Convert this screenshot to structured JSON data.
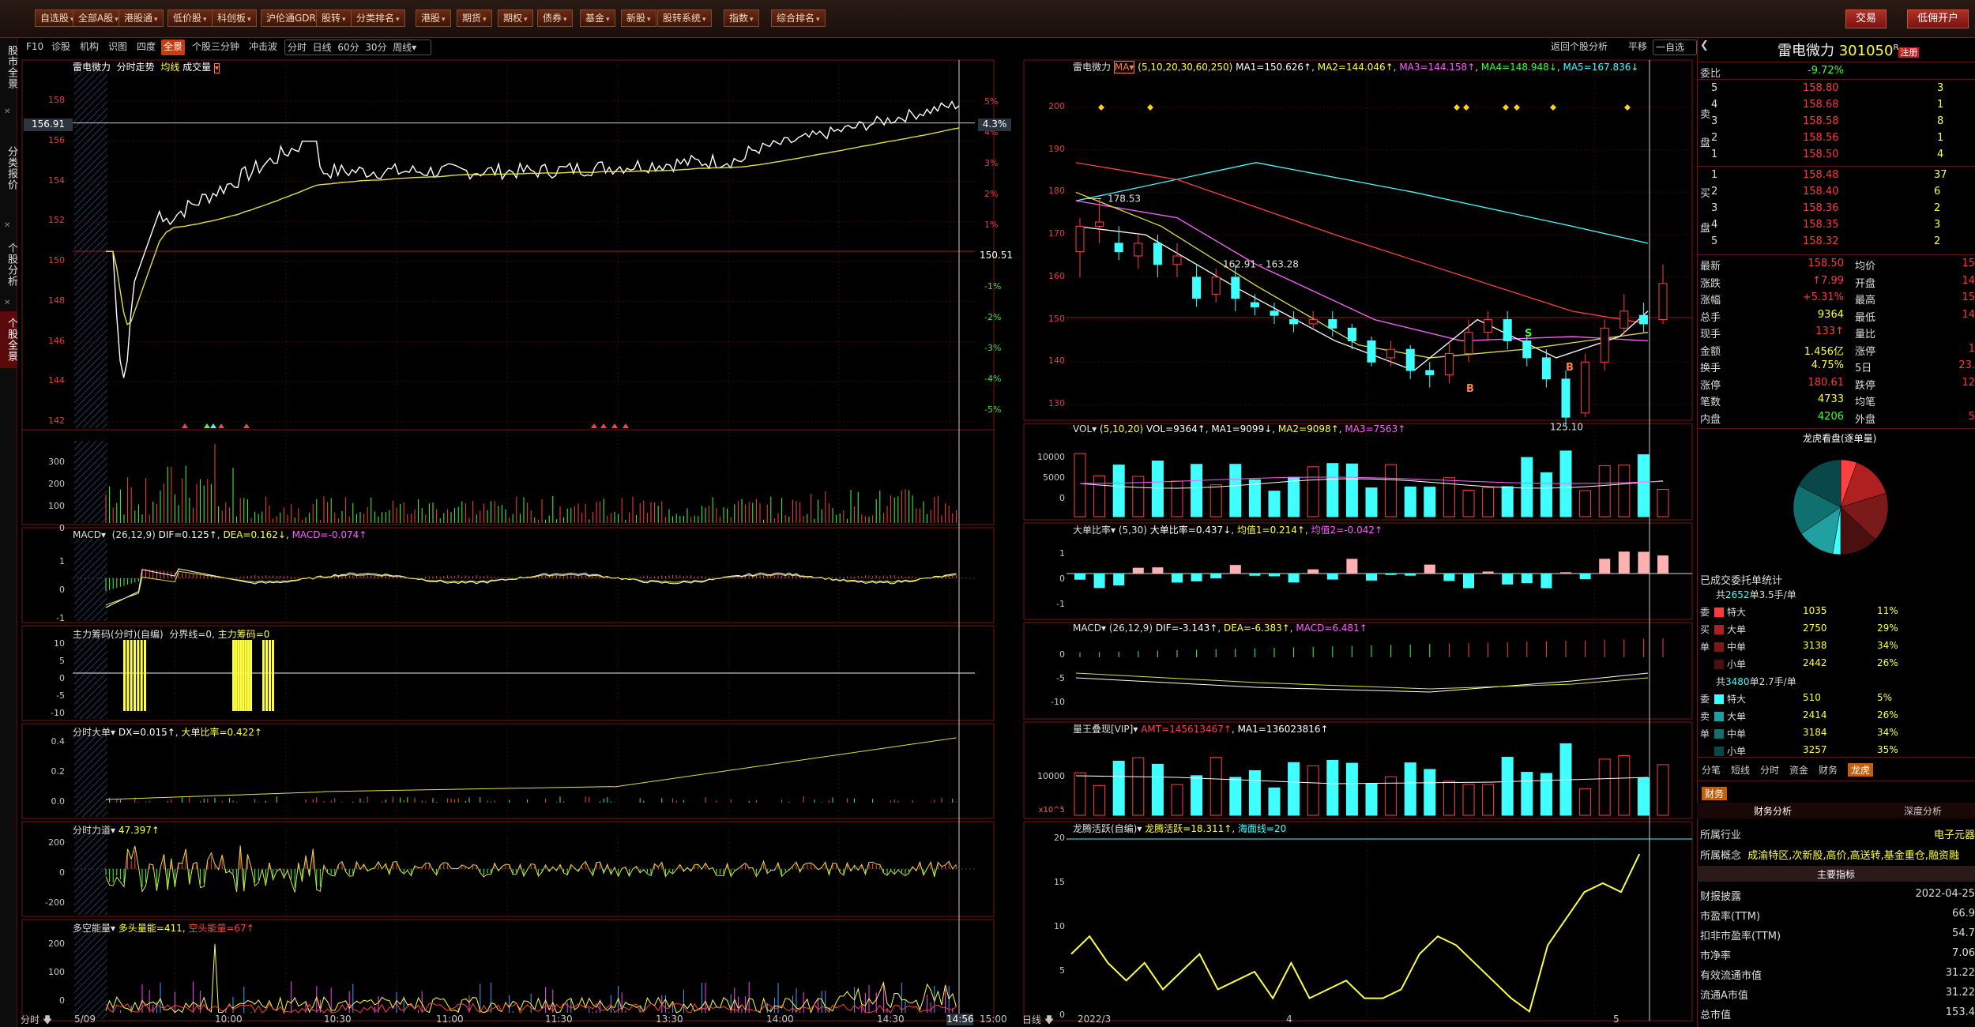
{
  "top_menu": [
    "自选股",
    "全部A股",
    "港股通",
    "低价股",
    "科创板",
    "沪伦通GDR",
    "股转",
    "分类排名",
    "港股",
    "期货",
    "期权",
    "债券",
    "基金",
    "新股",
    "股转系统",
    "指数",
    "综合排名"
  ],
  "top_right": {
    "trade": "交易",
    "open_account": "低佣开户"
  },
  "left_tabs": [
    "股市全景",
    "分类报价",
    "个股分析",
    "个股全景"
  ],
  "sub_toolbar": {
    "left": [
      "F10",
      "诊股",
      "机构",
      "识图",
      "四度",
      "全景",
      "个股三分钟",
      "冲击波"
    ],
    "periods": [
      "分时",
      "日线",
      "60分",
      "30分",
      "周线"
    ],
    "right": [
      "返回个股分析",
      "平移",
      "一自选"
    ]
  },
  "intraday": {
    "title": {
      "name": "雷电微力",
      "mode": "分时走势",
      "avg": "均线",
      "vol": "成交量"
    },
    "price_axis": [
      "158",
      "156",
      "154",
      "152",
      "150",
      "148",
      "146",
      "144",
      "142"
    ],
    "pct_axis": [
      "5%",
      "4%",
      "3%",
      "2%",
      "1%",
      "-1%",
      "-2%",
      "-3%",
      "-4%",
      "-5%"
    ],
    "cursor_price": "156.91",
    "cursor_pct": "4.3%",
    "baseline": "150.51",
    "vol_axis": [
      "300",
      "200",
      "100",
      "0"
    ],
    "macd_title": {
      "name": "MACD",
      "params": "(26,12,9)",
      "dif": "DIF=0.125↑",
      "dea": "DEA=0.162↓",
      "macd": "MACD=-0.074↑"
    },
    "macd_axis": [
      "1",
      "0",
      "-1"
    ],
    "zlcm_title": {
      "name": "主力筹码(分时)(自编)",
      "line": "分界线=0",
      "val": "主力筹码=0"
    },
    "zlcm_axis": [
      "10",
      "5",
      "0",
      "-5",
      "-10"
    ],
    "dd_title": {
      "name": "分时大单",
      "dx": "DX=0.015↑",
      "ratio": "大单比率=0.422↑"
    },
    "dd_axis": [
      "0.4",
      "0.2",
      "0.0"
    ],
    "ld_title": {
      "name": "分时力道",
      "val": "47.397↑"
    },
    "ld_axis": [
      "200",
      "0",
      "-200"
    ],
    "dkn_title": {
      "name": "多空能量",
      "long": "多头量能=411",
      "short": "空头能量=67↑"
    },
    "dkn_axis": [
      "200",
      "100",
      "0"
    ],
    "time_labels": [
      "5/09",
      "10:00",
      "10:30",
      "11:00",
      "11:30",
      "13:30",
      "14:00",
      "14:30",
      "14:56",
      "15:00"
    ],
    "bottom_tab": "分时"
  },
  "kline": {
    "title": {
      "name": "雷电微力",
      "ma": "MA",
      "params": "(5,10,20,30,60,250)",
      "ma1": "MA1=150.626↑",
      "ma2": "MA2=144.046↑",
      "ma3": "MA3=144.158↑",
      "ma4": "MA4=148.948↓",
      "ma5": "MA5=167.836↓"
    },
    "price_axis": [
      "200",
      "190",
      "180",
      "170",
      "160",
      "150",
      "140",
      "130"
    ],
    "annotations": {
      "high": "178.53",
      "mid": "162.91 - 163.28",
      "low": "125.10",
      "b1": "B",
      "b2": "B",
      "s1": "S"
    },
    "vol_title": {
      "name": "VOL",
      "params": "(5,10,20)",
      "vol": "VOL=9364↑",
      "ma1": "MA1=9099↓",
      "ma2": "MA2=9098↑",
      "ma3": "MA3=7563↑"
    },
    "vol_axis": [
      "10000",
      "5000",
      "0"
    ],
    "ddbl_title": {
      "name": "大单比率",
      "params": "(5,30)",
      "val": "大单比率=0.437↓",
      "avg1": "均值1=0.214↑",
      "avg2": "均值2=-0.042↑"
    },
    "ddbl_axis": [
      "1",
      "0",
      "-1"
    ],
    "macd_title": {
      "name": "MACD",
      "params": "(26,12,9)",
      "dif": "DIF=-3.143↑",
      "dea": "DEA=-6.383↑",
      "macd": "MACD=6.481↑"
    },
    "macd_axis": [
      "0",
      "-5",
      "-10"
    ],
    "lwt_title": {
      "name": "量王叠现[VIP]",
      "amt": "AMT=145613467↑",
      "ma1": "MA1=136023816↑"
    },
    "lwt_axis": [
      "10000",
      "x10^5"
    ],
    "lthy_title": {
      "name": "龙腾活跃(自编)",
      "val": "龙腾活跃=18.311↑",
      "line": "海面线=20"
    },
    "lthy_axis": [
      "20",
      "15",
      "10",
      "5",
      "0"
    ],
    "date_labels": [
      "2022/3",
      "4",
      "5"
    ],
    "bottom_tab": "日线"
  },
  "quote": {
    "name": "雷电微力",
    "code": "301050",
    "flag": "R",
    "tag": "注册",
    "weibi_label": "委比",
    "weibi": "-9.72%",
    "asks": [
      {
        "label": "5",
        "price": "158.80",
        "vol": "3"
      },
      {
        "label": "4",
        "price": "158.68",
        "vol": "1"
      },
      {
        "label": "3",
        "price": "158.58",
        "vol": "8"
      },
      {
        "label": "2",
        "price": "158.56",
        "vol": "1"
      },
      {
        "label": "1",
        "price": "158.50",
        "vol": "4"
      }
    ],
    "bids": [
      {
        "label": "1",
        "price": "158.48",
        "vol": "37"
      },
      {
        "label": "2",
        "price": "158.40",
        "vol": "6"
      },
      {
        "label": "3",
        "price": "158.36",
        "vol": "2"
      },
      {
        "label": "4",
        "price": "158.35",
        "vol": "3"
      },
      {
        "label": "5",
        "price": "158.32",
        "vol": "2"
      }
    ],
    "ask_side_label": "卖盘",
    "bid_side_label": "买盘",
    "stats": [
      {
        "k": "最新",
        "v": "158.50",
        "k2": "均价",
        "v2": "15"
      },
      {
        "k": "涨跌",
        "v": "↑7.99",
        "k2": "开盘",
        "v2": "14"
      },
      {
        "k": "涨幅",
        "v": "+5.31%",
        "k2": "最高",
        "v2": "15"
      },
      {
        "k": "总手",
        "v": "9364",
        "k2": "最低",
        "v2": "14"
      },
      {
        "k": "现手",
        "v": "133↑",
        "k2": "量比",
        "v2": ""
      },
      {
        "k": "金额",
        "v": "1.456亿",
        "k2": "涨停",
        "v2": "1"
      },
      {
        "k": "换手",
        "v": "4.75%",
        "k2": "5日",
        "v2": "23."
      },
      {
        "k": "涨停",
        "v": "180.61",
        "k2": "跌停",
        "v2": "12"
      },
      {
        "k": "笔数",
        "v": "4733",
        "k2": "均笔",
        "v2": ""
      },
      {
        "k": "内盘",
        "v": "4206",
        "k2": "外盘",
        "v2": "5"
      }
    ],
    "pie_title": "龙虎看盘(逐单量)",
    "pie_slices": [
      {
        "name": "特大买",
        "value": 1035
      },
      {
        "name": "大单买",
        "value": 2750
      },
      {
        "name": "中单买",
        "value": 3138
      },
      {
        "name": "小单买",
        "value": 2442
      },
      {
        "name": "特大卖",
        "value": 510
      },
      {
        "name": "大单卖",
        "value": 2414
      },
      {
        "name": "中单卖",
        "value": 3184
      },
      {
        "name": "小单卖",
        "value": 3257
      }
    ],
    "deal_stat": "已成交委托单统计",
    "buy_summary": {
      "prefix": "共",
      "count": "2652",
      "mid": "单",
      "avg": "3.5",
      "suffix": "手/单"
    },
    "buy_rows": [
      {
        "side": "委",
        "type": "特大",
        "val": "1035",
        "pct": "11%",
        "color": "#ff3a3a"
      },
      {
        "side": "买",
        "type": "大单",
        "val": "2750",
        "pct": "29%",
        "color": "#b02020"
      },
      {
        "side": "单",
        "type": "中单",
        "val": "3138",
        "pct": "34%",
        "color": "#7a1a1a"
      },
      {
        "side": "",
        "type": "小单",
        "val": "2442",
        "pct": "26%",
        "color": "#4a1010"
      }
    ],
    "sell_summary": {
      "prefix": "共",
      "count": "3480",
      "mid": "单",
      "avg": "2.7",
      "suffix": "手/单"
    },
    "sell_rows": [
      {
        "side": "委",
        "type": "特大",
        "val": "510",
        "pct": "5%",
        "color": "#40ffff"
      },
      {
        "side": "卖",
        "type": "大单",
        "val": "2414",
        "pct": "26%",
        "color": "#20a0a0"
      },
      {
        "side": "单",
        "type": "中单",
        "val": "3184",
        "pct": "34%",
        "color": "#107070"
      },
      {
        "side": "",
        "type": "小单",
        "val": "3257",
        "pct": "35%",
        "color": "#084848"
      }
    ],
    "tabs": [
      "分笔",
      "短线",
      "分时",
      "资金",
      "财务",
      "龙虎"
    ],
    "fin_tab": "财务",
    "fin_subtabs": [
      "财务分析",
      "深度分析"
    ],
    "industry": {
      "k": "所属行业",
      "v": "电子元器"
    },
    "concept": {
      "k": "所属概念",
      "v": "成渝特区,次新股,高价,高送转,基金重仓,融资融"
    },
    "main_index": "主要指标",
    "fin_rows": [
      {
        "k": "财报披露",
        "v": "2022-04-25"
      },
      {
        "k": "市盈率(TTM)",
        "v": "66.9"
      },
      {
        "k": "扣非市盈率(TTM)",
        "v": "54.7"
      },
      {
        "k": "市净率",
        "v": "7.06"
      },
      {
        "k": "有效流通市值",
        "v": "31.22"
      },
      {
        "k": "流通A市值",
        "v": "31.22"
      },
      {
        "k": "总市值",
        "v": "153.4"
      }
    ]
  }
}
